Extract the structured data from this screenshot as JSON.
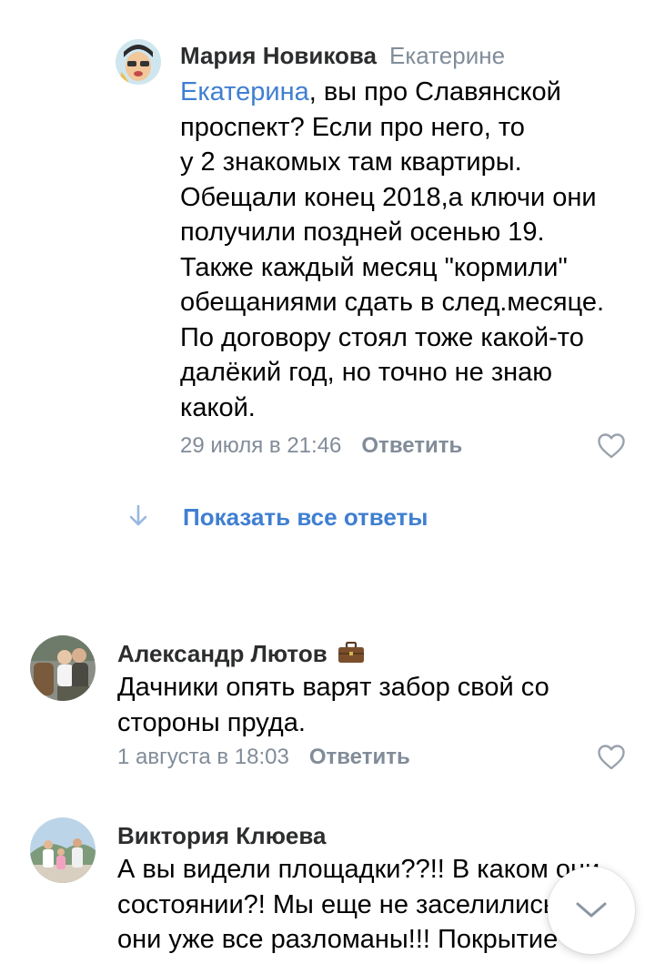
{
  "comments": [
    {
      "author": "Мария Новикова",
      "reply_to": "Екатерине",
      "mention": "Екатерина",
      "lines": [
        ", вы про Славянской",
        "проспект? Если про него, то",
        "у 2 знакомых там квартиры.",
        "Обещали конец 2018,а ключи они",
        "получили поздней осенью 19.",
        "Также каждый месяц \"кормили\"",
        "обещаниями сдать в след.месяце.",
        "По договору стоял тоже какой-то",
        "далёкий год, но точно не знаю",
        "какой."
      ],
      "date": "29 июля в 21:46",
      "reply_label": "Ответить"
    },
    {
      "author": "Александр Лютов",
      "lines": [
        "Дачники опять варят забор свой со",
        "стороны пруда."
      ],
      "date": "1 августа в 18:03",
      "reply_label": "Ответить"
    },
    {
      "author": "Виктория Клюева",
      "lines": [
        "А вы видели площадки??!! В каком они",
        "состоянии?! Мы еще не заселились, а",
        "они уже все разломаны!!! Покрытие"
      ]
    }
  ],
  "show_all_replies": "Показать все ответы",
  "colors": {
    "accent": "#3f7fd1",
    "secondary_text": "#818c99",
    "name_text": "#2c2d2e"
  },
  "icons": [
    "arrow-down-icon",
    "heart-outline-icon",
    "briefcase-icon",
    "chevron-down-icon"
  ]
}
